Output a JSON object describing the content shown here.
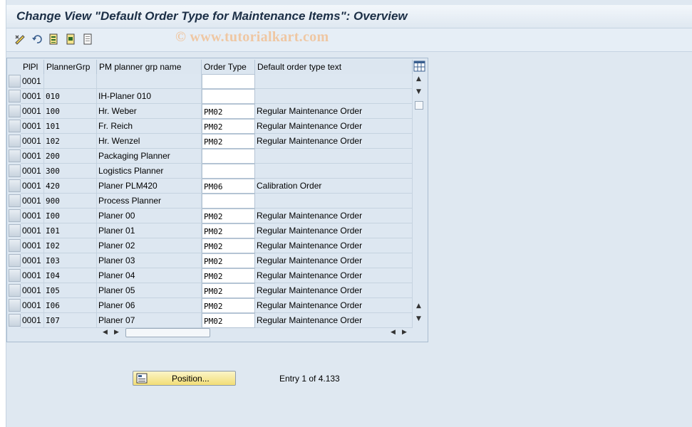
{
  "window": {
    "title": "Change View \"Default Order Type for Maintenance Items\": Overview"
  },
  "watermark": "© www.tutorialkart.com",
  "toolbar": {
    "buttons": [
      {
        "name": "display-change-icon"
      },
      {
        "name": "undo-icon"
      },
      {
        "name": "select-all-icon"
      },
      {
        "name": "select-block-icon"
      },
      {
        "name": "deselect-all-icon"
      }
    ]
  },
  "table": {
    "columns": [
      "PlPl",
      "PlannerGrp",
      "PM planner grp name",
      "Order Type",
      "Default order type text"
    ],
    "rows": [
      {
        "plpl": "0001",
        "grp": "",
        "name": "",
        "type": "",
        "text": ""
      },
      {
        "plpl": "0001",
        "grp": "010",
        "name": "IH-Planer 010",
        "type": "",
        "text": ""
      },
      {
        "plpl": "0001",
        "grp": "100",
        "name": "Hr. Weber",
        "type": "PM02",
        "text": "Regular Maintenance Order"
      },
      {
        "plpl": "0001",
        "grp": "101",
        "name": "Fr. Reich",
        "type": "PM02",
        "text": "Regular Maintenance Order"
      },
      {
        "plpl": "0001",
        "grp": "102",
        "name": "Hr. Wenzel",
        "type": "PM02",
        "text": "Regular Maintenance Order"
      },
      {
        "plpl": "0001",
        "grp": "200",
        "name": "Packaging Planner",
        "type": "",
        "text": ""
      },
      {
        "plpl": "0001",
        "grp": "300",
        "name": "Logistics Planner",
        "type": "",
        "text": ""
      },
      {
        "plpl": "0001",
        "grp": "420",
        "name": "Planer PLM420",
        "type": "PM06",
        "text": "Calibration Order"
      },
      {
        "plpl": "0001",
        "grp": "900",
        "name": "Process Planner",
        "type": "",
        "text": ""
      },
      {
        "plpl": "0001",
        "grp": "I00",
        "name": "Planer 00",
        "type": "PM02",
        "text": "Regular Maintenance Order"
      },
      {
        "plpl": "0001",
        "grp": "I01",
        "name": "Planer 01",
        "type": "PM02",
        "text": "Regular Maintenance Order"
      },
      {
        "plpl": "0001",
        "grp": "I02",
        "name": "Planer 02",
        "type": "PM02",
        "text": "Regular Maintenance Order"
      },
      {
        "plpl": "0001",
        "grp": "I03",
        "name": "Planer 03",
        "type": "PM02",
        "text": "Regular Maintenance Order"
      },
      {
        "plpl": "0001",
        "grp": "I04",
        "name": "Planer 04",
        "type": "PM02",
        "text": "Regular Maintenance Order"
      },
      {
        "plpl": "0001",
        "grp": "I05",
        "name": "Planer 05",
        "type": "PM02",
        "text": "Regular Maintenance Order"
      },
      {
        "plpl": "0001",
        "grp": "I06",
        "name": "Planer 06",
        "type": "PM02",
        "text": "Regular Maintenance Order"
      },
      {
        "plpl": "0001",
        "grp": "I07",
        "name": "Planer 07",
        "type": "PM02",
        "text": "Regular Maintenance Order"
      }
    ]
  },
  "footer": {
    "position_label": "Position...",
    "entry_text": "Entry 1 of 4.133"
  }
}
